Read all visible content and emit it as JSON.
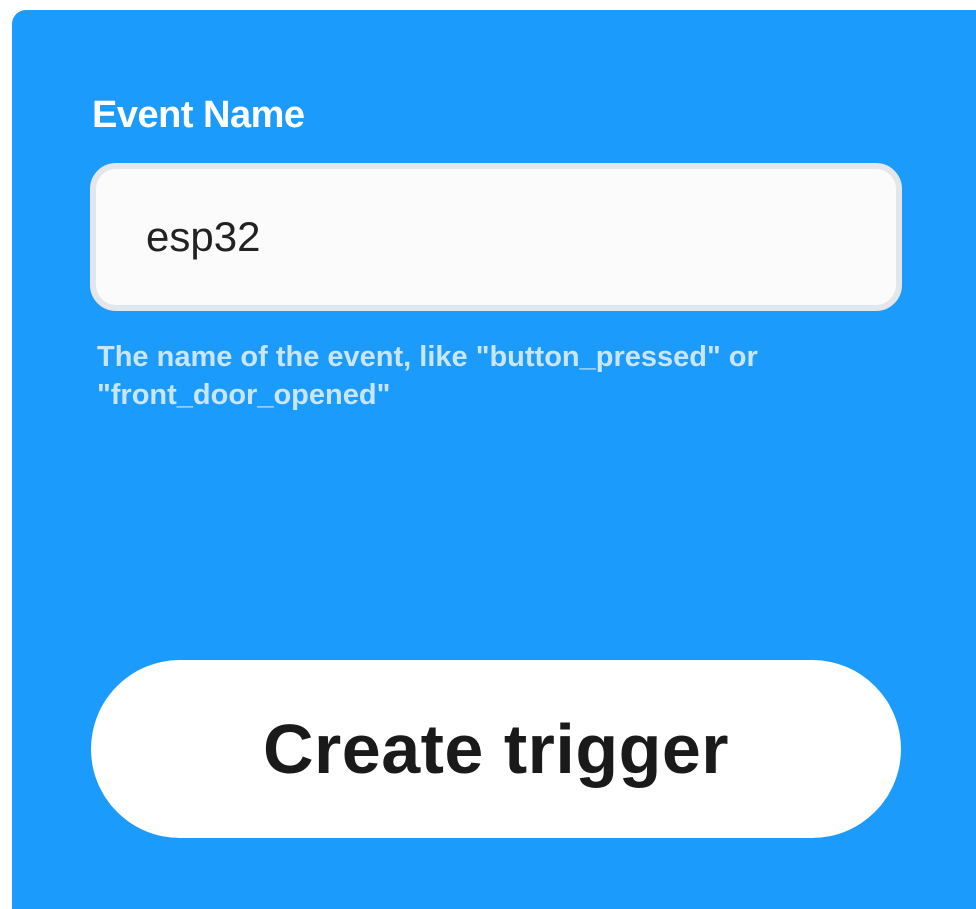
{
  "form": {
    "event_name_label": "Event Name",
    "event_name_value": "esp32",
    "help_text_line1": "The name of the event, like \"button_pressed\" or",
    "help_text_line2": "\"front_door_opened\"",
    "create_button_label": "Create trigger"
  },
  "colors": {
    "panel_background": "#1b9bfb",
    "button_background": "#ffffff",
    "input_background": "#fbfbfb"
  }
}
